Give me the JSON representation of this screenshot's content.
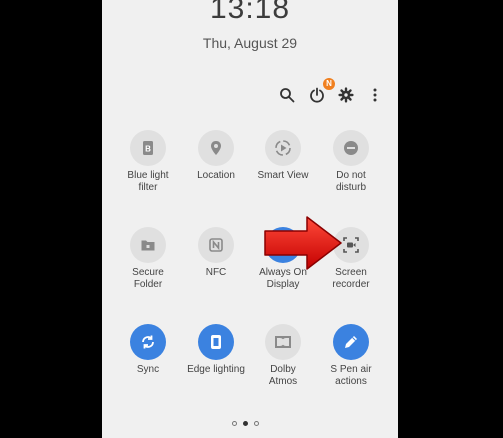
{
  "status": {
    "time": "13:18",
    "date": "Thu, August 29"
  },
  "toolbar": {
    "notification_badge": "N"
  },
  "tiles": [
    {
      "label": "Blue light\nfilter",
      "icon": "bluelight-icon",
      "active": false
    },
    {
      "label": "Location",
      "icon": "location-icon",
      "active": false
    },
    {
      "label": "Smart View",
      "icon": "smartview-icon",
      "active": false
    },
    {
      "label": "Do not\ndisturb",
      "icon": "dnd-icon",
      "active": false
    },
    {
      "label": "Secure\nFolder",
      "icon": "securefolder-icon",
      "active": false
    },
    {
      "label": "NFC",
      "icon": "nfc-icon",
      "active": false
    },
    {
      "label": "Always On\nDisplay",
      "icon": "aod-icon",
      "active": true
    },
    {
      "label": "Screen\nrecorder",
      "icon": "screenrecorder-icon",
      "active": false
    },
    {
      "label": "Sync",
      "icon": "sync-icon",
      "active": true
    },
    {
      "label": "Edge lighting",
      "icon": "edgelighting-icon",
      "active": true
    },
    {
      "label": "Dolby\nAtmos",
      "icon": "dolby-icon",
      "active": false
    },
    {
      "label": "S Pen air\nactions",
      "icon": "spen-icon",
      "active": true
    }
  ],
  "pagination": {
    "pages": 3,
    "current": 2
  },
  "colors": {
    "active": "#3b82e0",
    "inactive": "#e0e0e0",
    "arrow": "#e02020"
  }
}
